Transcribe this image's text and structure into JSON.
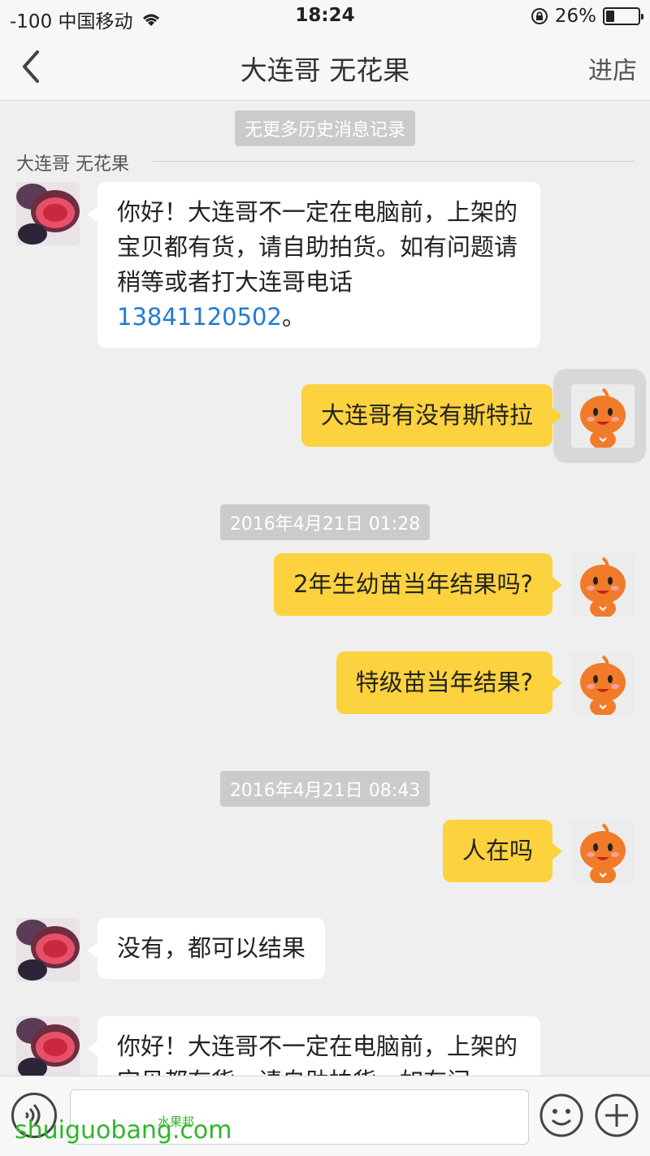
{
  "status_bar": {
    "carrier": "-100 中国移动",
    "time": "18:24",
    "battery_text": "26%",
    "battery_level": 0.26
  },
  "nav": {
    "title": "大连哥 无花果",
    "right_action": "进店"
  },
  "chat": {
    "history_notice": "无更多历史消息记录",
    "sender_name": "大连哥 无花果",
    "messages": [
      {
        "side": "in",
        "text_main": "你好！大连哥不一定在电脑前，上架的宝贝都有货，请自助拍货。如有问题请稍等或者打大连哥电话",
        "phone": "13841120502",
        "text_end": "。"
      },
      {
        "side": "out",
        "text": "大连哥有没有斯特拉"
      },
      {
        "side": "time",
        "text": "2016年4月21日 01:28"
      },
      {
        "side": "out",
        "text": "2年生幼苗当年结果吗?"
      },
      {
        "side": "out",
        "text": "特级苗当年结果?"
      },
      {
        "side": "time",
        "text": "2016年4月21日 08:43"
      },
      {
        "side": "out",
        "text": "人在吗"
      },
      {
        "side": "in",
        "text": "没有，都可以结果"
      },
      {
        "side": "in",
        "text": "你好！大连哥不一定在电脑前，上架的宝贝都有货，请自助拍货。如有问"
      }
    ]
  },
  "input_bar": {
    "placeholder": "",
    "icons": [
      "voice-icon",
      "emoji-icon",
      "plus-icon"
    ]
  },
  "watermark": {
    "text": "shuiguobang.com",
    "sub_text": "水果邦"
  },
  "colors": {
    "outgoing_bubble": "#fcd23e",
    "incoming_bubble": "#ffffff",
    "background": "#efefef",
    "link": "#1f7bd4",
    "watermark": "#2fb52b"
  }
}
